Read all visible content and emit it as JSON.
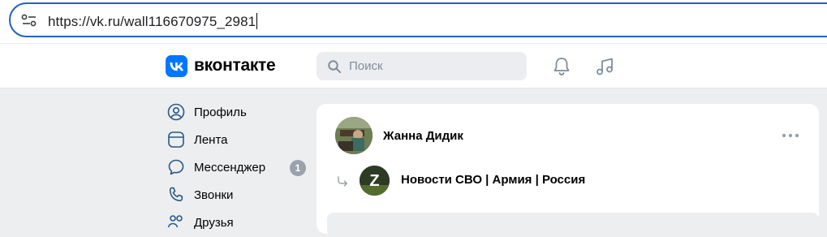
{
  "browser": {
    "url": "https://vk.ru/wall116670975_2981",
    "site_info_icon": "tune-icon"
  },
  "header": {
    "logo_text": "вконтакте",
    "search_placeholder": "Поиск",
    "icons": [
      "bell-icon",
      "music-icon"
    ]
  },
  "nav": {
    "items": [
      {
        "label": "Профиль",
        "icon": "user-circle-icon"
      },
      {
        "label": "Лента",
        "icon": "feed-icon"
      },
      {
        "label": "Мессенджер",
        "icon": "message-icon",
        "badge": "1"
      },
      {
        "label": "Звонки",
        "icon": "phone-icon"
      },
      {
        "label": "Друзья",
        "icon": "friends-icon"
      }
    ]
  },
  "post": {
    "author_name": "Жанна Дидик",
    "repost_source": "Новости СВО | Армия | Россия",
    "group_avatar_letter": "Z"
  },
  "colors": {
    "accent": "#0077ff",
    "url_border": "#1f63c4",
    "background": "#edeef0",
    "badge": "#99a2ad"
  }
}
